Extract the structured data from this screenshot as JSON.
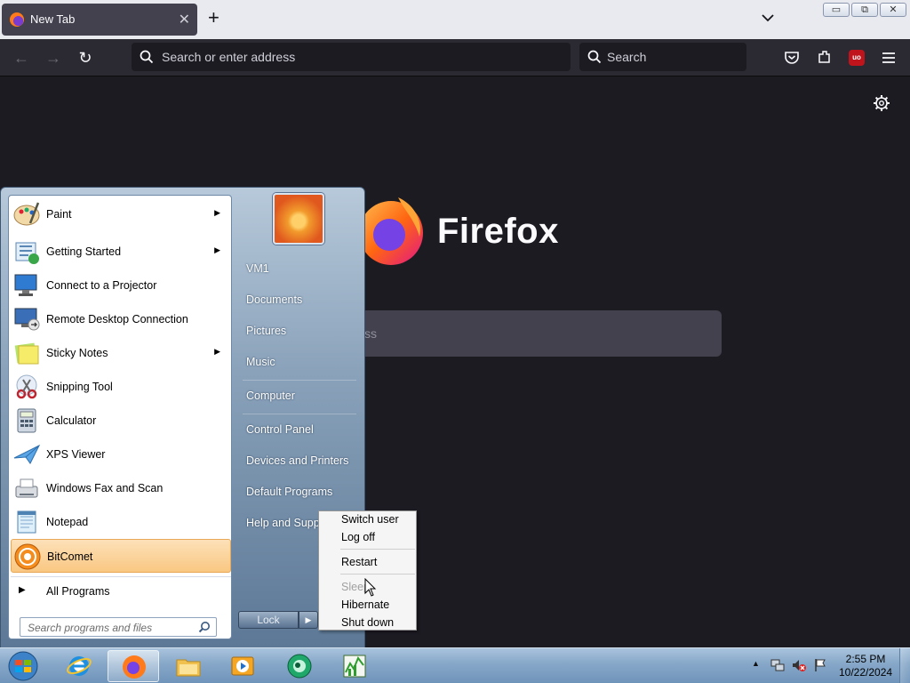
{
  "browser": {
    "tab_title": "New Tab",
    "url_placeholder": "Search or enter address",
    "search_placeholder": "Search",
    "brand_name": "Firefox",
    "content_search_placeholder_tail": "ss",
    "ublock_badge": "uo"
  },
  "start_menu": {
    "programs": [
      {
        "label": "Paint",
        "icon": "paint-icon",
        "has_submenu": true
      },
      {
        "label": "Getting Started",
        "icon": "getting-started-icon",
        "has_submenu": true
      },
      {
        "label": "Connect to a Projector",
        "icon": "projector-icon",
        "has_submenu": false
      },
      {
        "label": "Remote Desktop Connection",
        "icon": "remote-desktop-icon",
        "has_submenu": false
      },
      {
        "label": "Sticky Notes",
        "icon": "sticky-notes-icon",
        "has_submenu": true
      },
      {
        "label": "Snipping Tool",
        "icon": "snipping-tool-icon",
        "has_submenu": false
      },
      {
        "label": "Calculator",
        "icon": "calculator-icon",
        "has_submenu": false
      },
      {
        "label": "XPS Viewer",
        "icon": "xps-viewer-icon",
        "has_submenu": false
      },
      {
        "label": "Windows Fax and Scan",
        "icon": "fax-scan-icon",
        "has_submenu": false
      },
      {
        "label": "Notepad",
        "icon": "notepad-icon",
        "has_submenu": false
      },
      {
        "label": "BitComet",
        "icon": "bitcomet-icon",
        "has_submenu": false,
        "highlighted": true
      }
    ],
    "all_programs": "All Programs",
    "search_placeholder": "Search programs and files",
    "right_items": {
      "user": "VM1",
      "documents": "Documents",
      "pictures": "Pictures",
      "music": "Music",
      "computer": "Computer",
      "control_panel": "Control Panel",
      "devices_printers": "Devices and Printers",
      "default_programs": "Default Programs",
      "help_support": "Help and Suppo"
    },
    "lock_button": "Lock"
  },
  "power_menu": {
    "switch_user": "Switch user",
    "log_off": "Log off",
    "restart": "Restart",
    "sleep": "Sleep",
    "hibernate": "Hibernate",
    "shut_down": "Shut down"
  },
  "taskbar": {
    "pinned": [
      "internet-explorer-icon",
      "firefox-icon",
      "file-explorer-icon",
      "media-player-icon",
      "bitcomet-icon",
      "task-manager-icon"
    ],
    "clock_time": "2:55 PM",
    "clock_date": "10/22/2024"
  },
  "colors": {
    "firefox_bg": "#1c1b22",
    "toolbar": "#2b2a33",
    "highlight": "#f9c782"
  }
}
